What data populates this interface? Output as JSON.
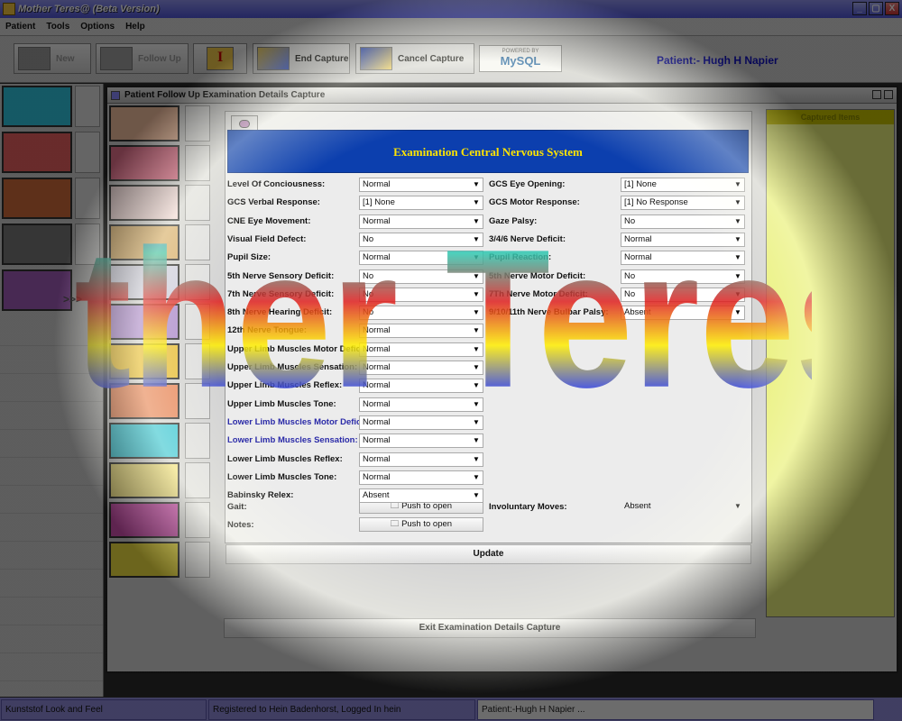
{
  "window": {
    "title": "Mother Teres@ (Beta Version)",
    "controls": [
      "_",
      "▢",
      "X"
    ]
  },
  "menu": [
    "Patient",
    "Tools",
    "Options",
    "Help"
  ],
  "toolbar": {
    "new_label": "New",
    "follow_up_label": "Follow Up",
    "end_capture_label": "End Capture",
    "cancel_capture_label": "Cancel Capture",
    "mysql_powered": "POWERED BY",
    "mysql_text": "MySQL",
    "patient_label": "Patient:- Hugh H Napier"
  },
  "left_nav": {
    "arrow": ">>>"
  },
  "frame": {
    "title": "Patient Follow Up Examination Details Capture",
    "header": "Examination Central Nervous System",
    "captured_title": "Captured Items",
    "update_label": "Update",
    "exit_label": "Exit Examination Details Capture"
  },
  "left_fields": [
    {
      "label": "Level Of Conciousness:",
      "value": "Normal"
    },
    {
      "label": "GCS Verbal Response:",
      "value": "[1] None"
    },
    {
      "label": "CNE Eye Movement:",
      "value": "Normal"
    },
    {
      "label": "Visual Field Defect:",
      "value": "No"
    },
    {
      "label": "Pupil Size:",
      "value": "Normal"
    },
    {
      "label": "5th Nerve Sensory Deficit:",
      "value": "No"
    },
    {
      "label": "7th Nerve Sensory Deficit:",
      "value": "No"
    },
    {
      "label": "8th Nerve Hearing Deficit:",
      "value": "No"
    },
    {
      "label": "12th Nerve Tongue:",
      "value": "Normal"
    },
    {
      "label": "Upper Limb Muscles Motor Deficit:",
      "value": "Normal"
    },
    {
      "label": "Upper Limb Muscles Sensation:",
      "value": "Normal"
    },
    {
      "label": "Upper Limb Muscles Reflex:",
      "value": "Normal"
    },
    {
      "label": "Upper Limb Muscles Tone:",
      "value": "Normal"
    },
    {
      "label": "Lower Limb Muscles Motor Deficit:",
      "value": "Normal"
    },
    {
      "label": "Lower Limb Muscles Sensation:",
      "value": "Normal"
    },
    {
      "label": "Lower Limb Muscles Reflex:",
      "value": "Normal"
    },
    {
      "label": "Lower Limb Muscles Tone:",
      "value": "Normal"
    },
    {
      "label": "Babinsky Relex:",
      "value": "Absent"
    }
  ],
  "right_fields": [
    {
      "label": "GCS Eye Opening:",
      "value": "[1] None"
    },
    {
      "label": "GCS Motor Response:",
      "value": "[1] No Response"
    },
    {
      "label": "Gaze Palsy:",
      "value": "No"
    },
    {
      "label": "3/4/6 Nerve Deficit:",
      "value": "Normal"
    },
    {
      "label": "Pupil Reaction:",
      "value": "Normal"
    },
    {
      "label": "5th Nerve Motor Deficit:",
      "value": "No"
    },
    {
      "label": "7Th Nerve Motor Deficit:",
      "value": "No"
    },
    {
      "label": "9/10/11th Nerve Bulbar Palsy:",
      "value": "Absent"
    }
  ],
  "gait": {
    "label": "Gait:",
    "button": "Push to open"
  },
  "notes": {
    "label": "Notes:",
    "button": "Push to open"
  },
  "involuntary": {
    "label": "Involuntary Moves:",
    "value": "Absent"
  },
  "status": {
    "laf": "Kunststof Look and Feel",
    "registered": "Registered to Hein Badenhorst, Logged In hein",
    "patient": "Patient:-Hugh H Napier ..."
  },
  "watermark": "Mother Teres@",
  "colors": {
    "header_bg": "#0c3fae",
    "header_text": "#ffe400",
    "patient_text": "#1010c0",
    "titlebar": "#5a60dc"
  }
}
